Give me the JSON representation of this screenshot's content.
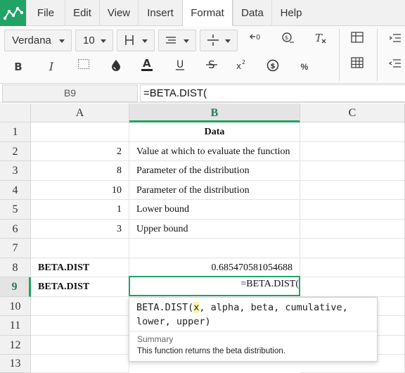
{
  "menu": {
    "items": [
      "File",
      "Edit",
      "View",
      "Insert",
      "Format",
      "Data",
      "Help"
    ],
    "active": "Format"
  },
  "toolbar": {
    "font_family": "Verdana",
    "font_size": "10",
    "row1_icons": [
      "borders-icon",
      "align-icon",
      "valign-icon",
      "decrease-decimal-icon",
      "currency-icon",
      "clear-format-icon",
      "table-icon",
      "indent-icon"
    ],
    "row2_icons": [
      "bold-icon",
      "italic-icon",
      "border-dotted-icon",
      "fill-color-icon",
      "text-color-icon",
      "underline-icon",
      "strikethrough-icon",
      "superscript-icon",
      "dollar-icon",
      "percent-icon",
      "grid-icon",
      "outdent-icon"
    ],
    "accent_color": "#21a366"
  },
  "formula_bar": {
    "cell_ref": "B9",
    "formula": "=BETA.DIST("
  },
  "columns": [
    "A",
    "B",
    "C"
  ],
  "selected_column": "B",
  "rows": [
    "1",
    "2",
    "3",
    "4",
    "5",
    "6",
    "7",
    "8",
    "9",
    "10",
    "11",
    "12",
    "13"
  ],
  "selected_row": "9",
  "cells": {
    "b1": "Data",
    "a2": "2",
    "b2": "Value at which to evaluate the function",
    "a3": "8",
    "b3": "Parameter of the distribution",
    "a4": "10",
    "b4": "Parameter of the distribution",
    "a5": "1",
    "b5": "Lower bound",
    "a6": "3",
    "b6": "Upper bound",
    "a8": "BETA.DIST",
    "b8": "0.685470581054688",
    "a9": "BETA.DIST",
    "b9": "=BETA.DIST("
  },
  "tooltip": {
    "fn": "BETA.DIST(",
    "arg_highlight": "x",
    "rest": ", alpha, beta, cumulative, lower, upper)",
    "summary_label": "Summary",
    "description": "This function returns the beta distribution."
  }
}
